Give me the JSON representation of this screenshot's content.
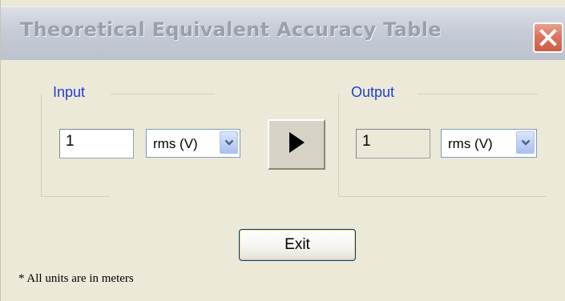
{
  "window": {
    "title": "Theoretical Equivalent Accuracy Table"
  },
  "input_group": {
    "label": "Input",
    "value": "1",
    "unit_selected": "rms (V)"
  },
  "output_group": {
    "label": "Output",
    "value": "1",
    "unit_selected": "rms (V)"
  },
  "buttons": {
    "exit_label": "Exit"
  },
  "footnote": "* All units are in meters",
  "icons": {
    "close": "close-icon",
    "convert": "play-arrow-icon",
    "dropdown": "chevron-down-icon"
  },
  "colors": {
    "group_label": "#1f3fd4",
    "close_button": "#d9735e",
    "dropdown_arrow": "#4d6185"
  }
}
